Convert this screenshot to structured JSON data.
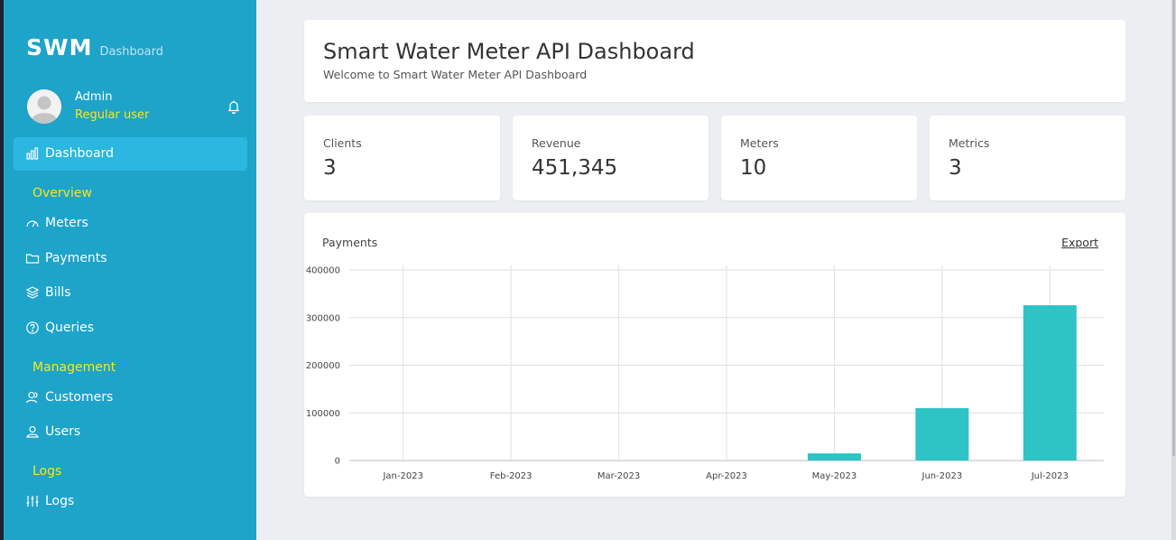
{
  "sidebar": {
    "brand": "SWM",
    "brand_sub": "Dashboard",
    "user": {
      "name": "Admin",
      "role": "Regular user"
    },
    "nav": {
      "dashboard": "Dashboard",
      "overview_section": "Overview",
      "meters": "Meters",
      "payments": "Payments",
      "bills": "Bills",
      "queries": "Queries",
      "management_section": "Management",
      "customers": "Customers",
      "users": "Users",
      "logs_section": "Logs",
      "logs": "Logs"
    }
  },
  "header": {
    "title": "Smart Water Meter API Dashboard",
    "subtitle": "Welcome to Smart Water Meter API Dashboard"
  },
  "stats": [
    {
      "label": "Clients",
      "value": "3"
    },
    {
      "label": "Revenue",
      "value": "451,345"
    },
    {
      "label": "Meters",
      "value": "10"
    },
    {
      "label": "Metrics",
      "value": "3"
    }
  ],
  "payments_card": {
    "title": "Payments",
    "export_label": "Export"
  },
  "colors": {
    "sidebar": "#1ea3c9",
    "active_nav": "#2bb7df",
    "accent_yellow": "#f6e81c",
    "bar": "#2ec4c6"
  },
  "chart_data": {
    "type": "bar",
    "categories": [
      "Jan-2023",
      "Feb-2023",
      "Mar-2023",
      "Apr-2023",
      "May-2023",
      "Jun-2023",
      "Jul-2023"
    ],
    "values": [
      0,
      0,
      0,
      0,
      15000,
      110000,
      326000
    ],
    "ylim": [
      0,
      400000
    ],
    "yticks": [
      0,
      100000,
      200000,
      300000,
      400000
    ],
    "grid": true
  }
}
